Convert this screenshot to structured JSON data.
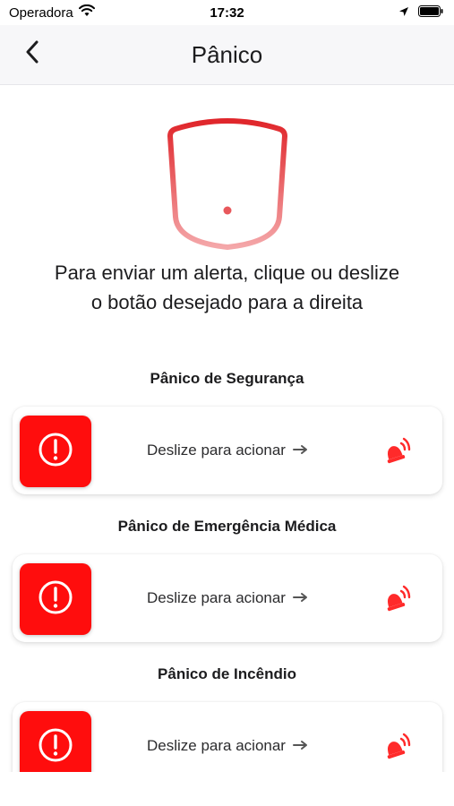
{
  "status_bar": {
    "carrier": "Operadora",
    "time": "17:32"
  },
  "nav": {
    "title": "Pânico"
  },
  "instructions": "Para enviar um alerta, clique ou deslize o botão desejado para a direita",
  "panics": [
    {
      "title": "Pânico de Segurança",
      "slider_label": "Deslize para acionar"
    },
    {
      "title": "Pânico de Emergência Médica",
      "slider_label": "Deslize para acionar"
    },
    {
      "title": "Pânico de Incêndio",
      "slider_label": "Deslize para acionar"
    }
  ],
  "colors": {
    "accent_red": "#ff0d0d",
    "shield_red": "#e0262b"
  },
  "icons": [
    "wifi-icon",
    "location-arrow-icon",
    "battery-icon",
    "back-chevron-icon",
    "shield-alert-icon",
    "exclamation-circle-icon",
    "arrow-right-icon",
    "alarm-siren-icon"
  ]
}
